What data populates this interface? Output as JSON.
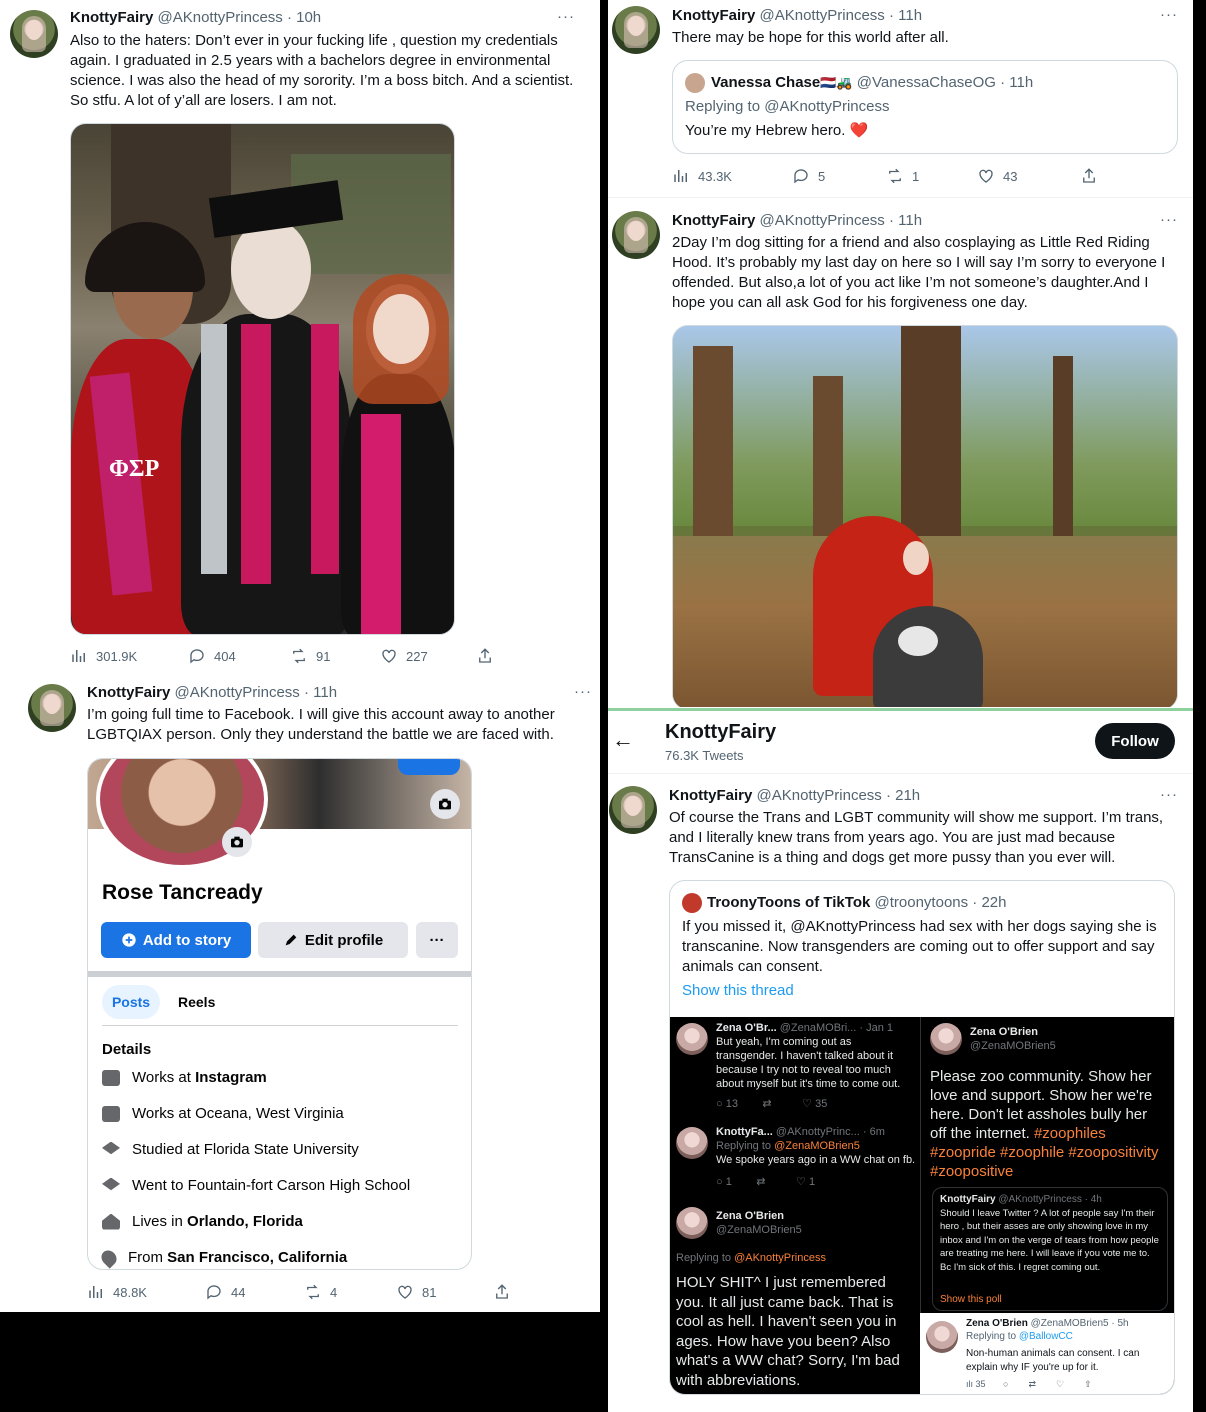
{
  "colors": {
    "link": "#1d9bf0",
    "text": "#0f1419",
    "muted": "#536471",
    "fb_blue": "#1b74e4",
    "orange": "#f9813a",
    "heart": "#f91880"
  },
  "tweet1": {
    "name": "KnottyFairy",
    "handle": "@AKnottyPrincess · 10h",
    "text": "Also to the haters: Don’t ever in your fucking life , question my credentials again. I graduated in 2.5 years with a bachelors degree in environmental science. I was also the head of my sorority. I’m a boss bitch. And a scientist. So stfu. A lot of y’all are losers. I am not.",
    "views": "301.9K",
    "replies": "404",
    "retweets": "91",
    "likes": "227",
    "sash_letters": "ΦΣΡ"
  },
  "tweet2": {
    "name": "KnottyFairy",
    "handle": "@AKnottyPrincess · 11h",
    "text": "There may be hope for this world after all.",
    "quote": {
      "name": "Vanessa Chase",
      "flags": "🇳🇱🚜",
      "handle": "@VanessaChaseOG · 11h",
      "replying": "Replying to @AKnottyPrincess",
      "text": "You’re my Hebrew hero.",
      "heart": "❤️"
    },
    "views": "43.3K",
    "replies": "5",
    "retweets": "1",
    "likes": "43"
  },
  "tweet3": {
    "name": "KnottyFairy",
    "handle": "@AKnottyPrincess · 11h",
    "text": "2Day I’m dog sitting for a friend and also cosplaying as Little Red Riding Hood. It’s probably my last day on here so I will say I’m sorry to everyone I offended. But also,a lot of you act like I’m not someone’s daughter.And I hope you can all ask God for his forgiveness one day."
  },
  "tweet4": {
    "name": "KnottyFairy",
    "handle": "@AKnottyPrincess · 11h",
    "text": "I’m going full time to Facebook. I will give this account away to another LGBTQIAX person. Only they understand the battle we are faced with.",
    "fb": {
      "name": "Rose Tancready",
      "add_story": "Add to story",
      "edit_profile": "Edit profile",
      "more": "···",
      "tabs": [
        "Posts",
        "Reels"
      ],
      "details_title": "Details",
      "details": [
        {
          "pre": "Works at ",
          "bold": "Instagram"
        },
        {
          "pre": "Works at Oceana, West Virginia",
          "bold": ""
        },
        {
          "pre": "Studied at Florida State University",
          "bold": ""
        },
        {
          "pre": "Went to Fountain-fort Carson High School",
          "bold": ""
        },
        {
          "pre": "Lives in ",
          "bold": "Orlando, Florida"
        },
        {
          "pre": "From ",
          "bold": "San Francisco, California"
        }
      ]
    },
    "views": "48.8K",
    "replies": "44",
    "retweets": "4",
    "likes": "81"
  },
  "profile": {
    "back": "←",
    "name": "KnottyFairy",
    "tweets": "76.3K Tweets",
    "follow": "Follow"
  },
  "tweet5": {
    "name": "KnottyFairy",
    "handle": "@AKnottyPrincess · 21h",
    "text": "Of course the Trans and LGBT community will show me support. I’m trans, and I literally knew trans from years ago. You are just mad because TransCanine is a thing and dogs get more pussy than you ever will.",
    "quote": {
      "name": "TroonyToons of TikTok",
      "handle": "@troonytoons · 22h",
      "text": "If you missed it, @AKnottyPrincess had sex with her dogs saying she is transcanine. Now transgenders are coming out to offer support and say animals can consent.",
      "show_thread": "Show this thread"
    },
    "dark": {
      "a_name": "Zena O'Br...",
      "a_handle": "@ZenaMOBri... · Jan 1",
      "a_text": "But yeah, I'm coming out as transgender. I haven't talked about it because I try not to reveal too much about myself but it's time to come out.",
      "a_replies": "13",
      "a_likes": "35",
      "b_name": "KnottyFa...",
      "b_handle": "@AKnottyPrinc... · 6m",
      "b_replying": "Replying to ",
      "b_replying_to": "@ZenaMOBrien5",
      "b_text": "We spoke years ago in a WW chat on fb.",
      "b_replies": "1",
      "b_likes": "1",
      "c_name": "Zena O'Brien",
      "c_handle": "@ZenaMOBrien5",
      "c_replying": "Replying to ",
      "c_replying_to": "@AKnottyPrincess",
      "c_text": "HOLY SHIT^ I just remembered you. It all just came back. That is cool as hell. I haven't seen you in ages. How have you been? Also what's a WW chat? Sorry, I'm bad with abbreviations.",
      "d_name": "Zena O'Brien",
      "d_handle": "@ZenaMOBrien5",
      "d_text": "Please zoo community. Show her love and support. Show her we're here. Don't let assholes bully her off the internet. ",
      "d_tags": "#zoophiles #zoopride #zoophile #zoopositivity #zoopositive",
      "e_name": "KnottyFairy",
      "e_handle": "@AKnottyPrincess · 4h",
      "e_text": "Should I leave Twitter ? A lot of people say I'm their hero , but their asses are only showing love in my inbox and I'm on the verge of tears from how people are treating me here.  I will leave if you vote me to. Bc I'm sick of this.  I regret coming out.",
      "e_poll": "Show this poll",
      "f_name": "Zena O'Brien",
      "f_handle": "@ZenaMOBrien5 · 5h",
      "f_replying": "Replying to ",
      "f_replying_to": "@BallowCC",
      "f_text": "Non-human animals can consent. I can explain why IF you're up for it.",
      "f_views": "35"
    }
  }
}
